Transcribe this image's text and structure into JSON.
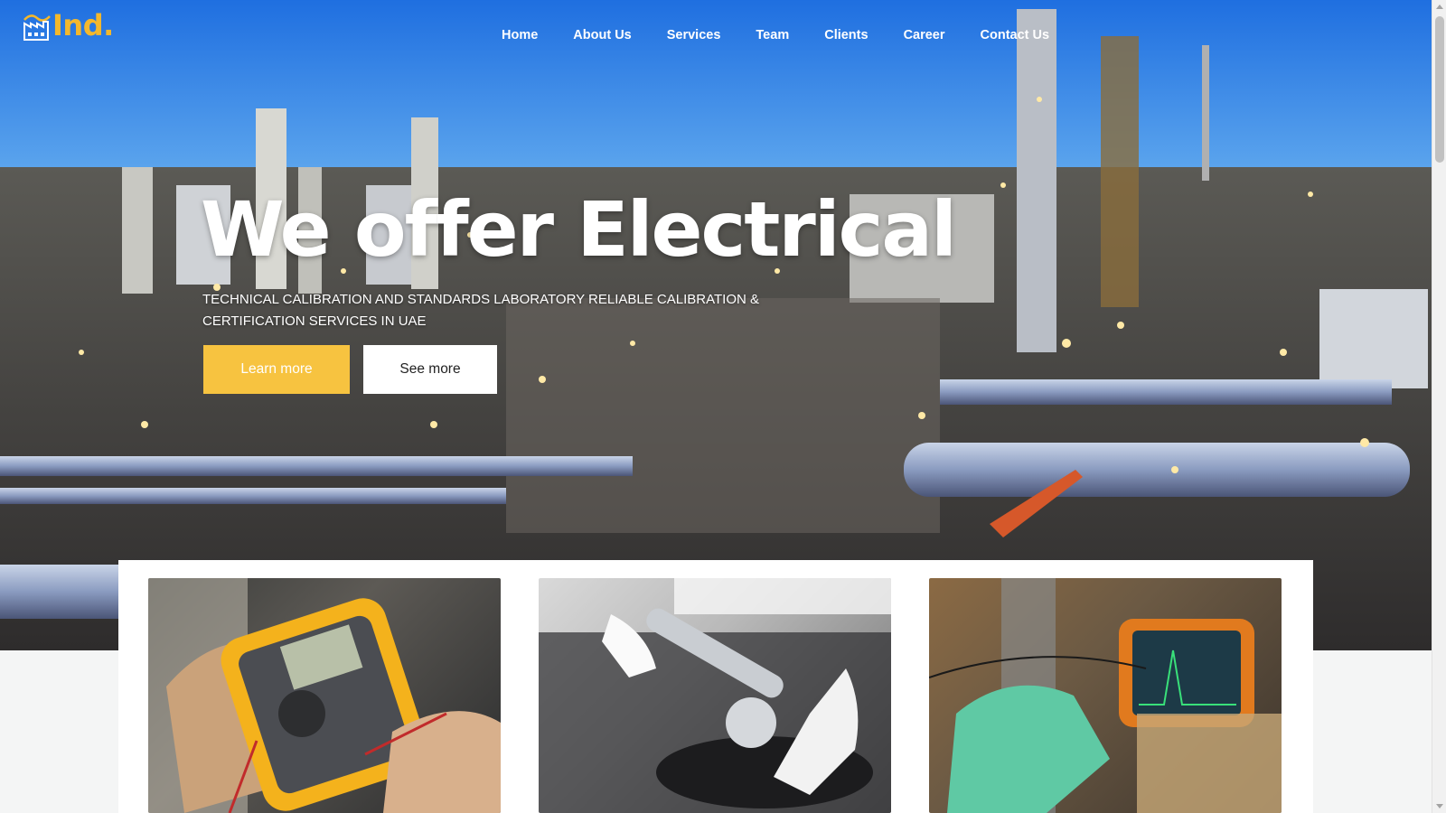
{
  "brand": {
    "name": "Ind."
  },
  "nav": {
    "items": [
      {
        "label": "Home"
      },
      {
        "label": "About Us"
      },
      {
        "label": "Services"
      },
      {
        "label": "Team"
      },
      {
        "label": "Clients"
      },
      {
        "label": "Career"
      },
      {
        "label": "Contact Us"
      }
    ]
  },
  "hero": {
    "headline": "We offer Electrical",
    "subline": "TECHNICAL CALIBRATION AND STANDARDS LABORATORY RELIABLE CALIBRATION & CERTIFICATION SERVICES IN UAE",
    "primary_button": "Learn more",
    "secondary_button": "See more"
  },
  "cards": [
    {
      "image": "multimeter-photo"
    },
    {
      "image": "torque-wrench-photo"
    },
    {
      "image": "ultrasonic-tester-photo"
    }
  ],
  "colors": {
    "accent": "#f7c340",
    "logo": "#f4b82c"
  }
}
